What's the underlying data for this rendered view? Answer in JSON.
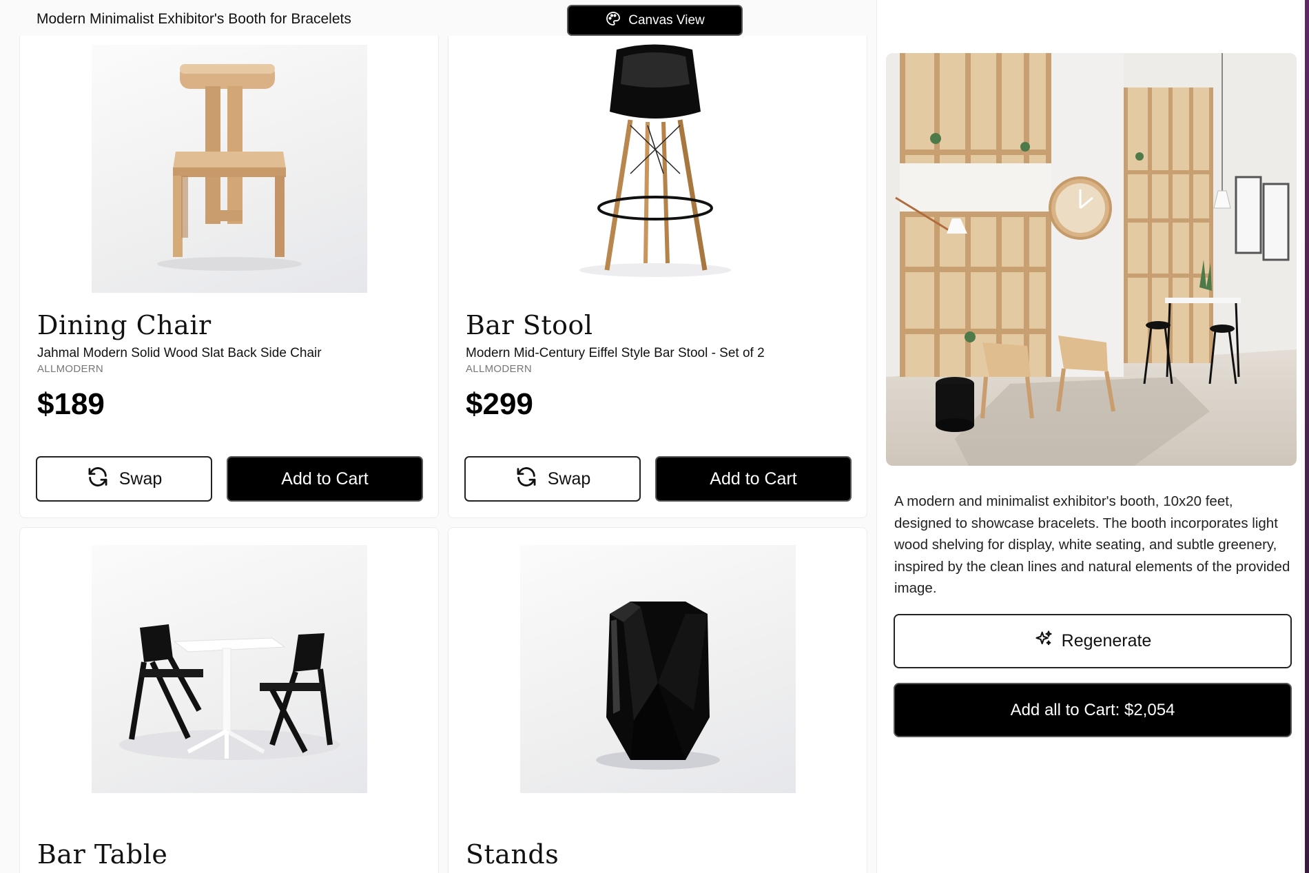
{
  "header": {
    "page_title": "Modern Minimalist Exhibitor's Booth for Bracelets",
    "canvas_view_label": "Canvas View"
  },
  "products": [
    {
      "category": "Dining Chair",
      "name": "Jahmal Modern Solid Wood Slat Back Side Chair",
      "brand": "ALLMODERN",
      "price": "$189",
      "swap_label": "Swap",
      "cart_label": "Add to Cart"
    },
    {
      "category": "Bar Stool",
      "name": "Modern Mid-Century Eiffel Style Bar Stool - Set of 2",
      "brand": "ALLMODERN",
      "price": "$299",
      "swap_label": "Swap",
      "cart_label": "Add to Cart"
    },
    {
      "category": "Bar Table"
    },
    {
      "category": "Stands"
    }
  ],
  "design": {
    "description": "A modern and minimalist exhibitor's booth, 10x20 feet, designed to showcase bracelets. The booth incorporates light wood shelving for display, white seating, and subtle greenery, inspired by the clean lines and natural elements of the provided image.",
    "regenerate_label": "Regenerate",
    "add_all_label": "Add all to Cart: $2,054"
  },
  "icons": {
    "canvas_view": "palette-icon",
    "swap": "refresh-icon",
    "regenerate": "sparkle-icon"
  },
  "colors": {
    "primary_button": "#000000",
    "accent_edge": "#4a2350"
  }
}
